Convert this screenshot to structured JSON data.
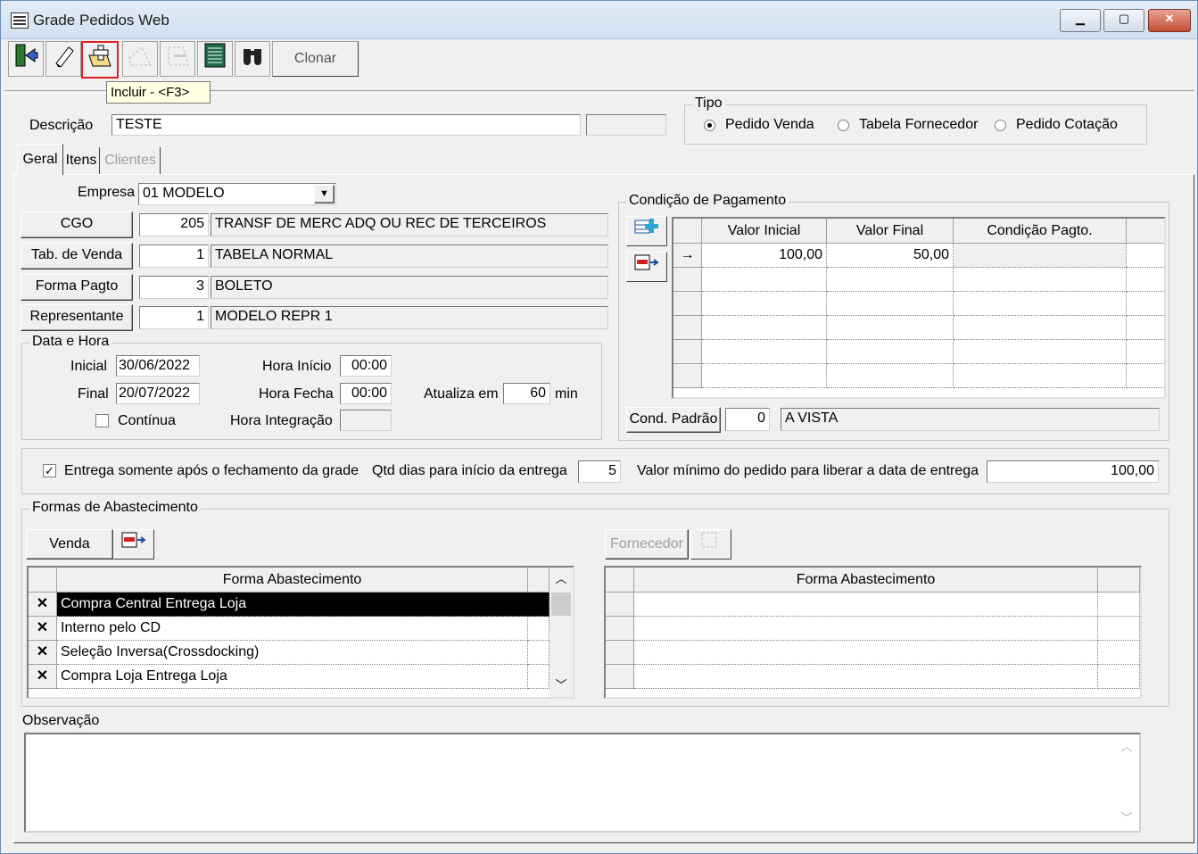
{
  "window": {
    "title": "Grade Pedidos Web",
    "min": "▁",
    "max": "▢",
    "close": "✕"
  },
  "toolbar": {
    "clonar_label": "Clonar",
    "tooltip": "Incluir - <F3>"
  },
  "header": {
    "descricao_label": "Descrição",
    "descricao_value": "TESTE",
    "tipo": {
      "label": "Tipo",
      "options": [
        "Pedido Venda",
        "Tabela Fornecedor",
        "Pedido Cotação"
      ],
      "selected": "Pedido Venda"
    }
  },
  "tabs": [
    "Geral",
    "Itens",
    "Clientes"
  ],
  "geral": {
    "empresa_label": "Empresa",
    "empresa_value": "01 MODELO",
    "cgo": {
      "button": "CGO",
      "code": "205",
      "desc": "TRANSF DE MERC ADQ OU REC DE TERCEIROS"
    },
    "tab_venda": {
      "button": "Tab. de Venda",
      "code": "1",
      "desc": "TABELA NORMAL"
    },
    "forma_pagto": {
      "button": "Forma Pagto",
      "code": "3",
      "desc": "BOLETO"
    },
    "representante": {
      "button": "Representante",
      "code": "1",
      "desc": "MODELO REPR 1"
    }
  },
  "data_hora": {
    "label": "Data e Hora",
    "inicial_label": "Inicial",
    "inicial_value": "30/06/2022",
    "final_label": "Final",
    "final_value": "20/07/2022",
    "continua_label": "Contínua",
    "hora_inicio_label": "Hora Início",
    "hora_inicio_value": "00:00",
    "hora_fecha_label": "Hora Fecha",
    "hora_fecha_value": "00:00",
    "hora_integracao_label": "Hora Integração",
    "atualiza_label": "Atualiza em",
    "atualiza_value": "60",
    "atualiza_unit": "min"
  },
  "condicao": {
    "label": "Condição de Pagamento",
    "columns": [
      "Valor Inicial",
      "Valor Final",
      "Condição Pagto."
    ],
    "rows": [
      {
        "valor_inicial": "100,00",
        "valor_final": "50,00",
        "condicao": ""
      }
    ],
    "cond_padrao_button": "Cond. Padrão",
    "cond_padrao_code": "0",
    "cond_padrao_desc": "A VISTA"
  },
  "entrega": {
    "checkbox_label": "Entrega somente após o fechamento da grade",
    "checked": true,
    "qtd_label": "Qtd dias para início da entrega",
    "qtd_value": "5",
    "valor_min_label": "Valor mínimo do pedido para liberar a data de entrega",
    "valor_min_value": "100,00"
  },
  "abastecimento": {
    "label": "Formas de Abastecimento",
    "venda_button": "Venda",
    "fornecedor_button": "Fornecedor",
    "column": "Forma Abastecimento",
    "venda_rows": [
      "Compra Central Entrega Loja",
      "Interno pelo CD",
      "Seleção Inversa(Crossdocking)",
      "Compra Loja Entrega Loja"
    ],
    "row_marker": "✕"
  },
  "observacao": {
    "label": "Observação",
    "value": ""
  }
}
